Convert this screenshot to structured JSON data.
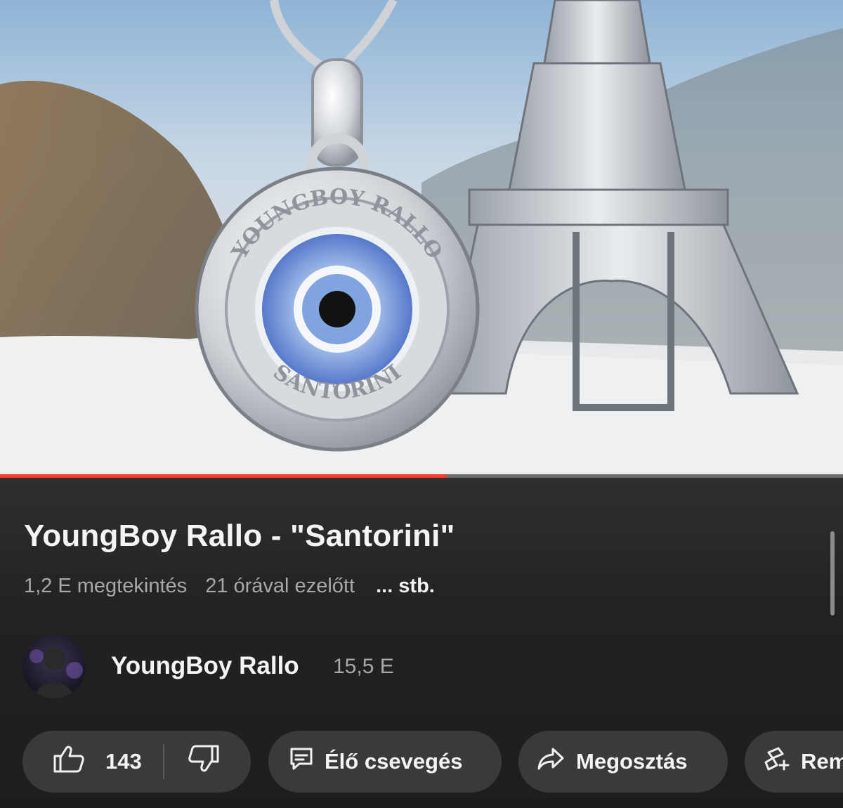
{
  "video": {
    "progress_fraction": 0.53,
    "progress_color": "#ff3b30",
    "thumbnail_description_icon": "pendant-eiffel-thumbnail",
    "pendant_top_text": "YOUNGBOY RALLO",
    "pendant_bottom_text": "SANTORINI"
  },
  "title": "YoungBoy Rallo - \"Santorini\"",
  "meta": {
    "views": "1,2 E megtekintés",
    "age": "21 órával ezelőtt",
    "more": "... stb."
  },
  "channel": {
    "name": "YoungBoy Rallo",
    "subscribers": "15,5 E"
  },
  "actions": {
    "like_count": "143",
    "like_icon": "thumbs-up-icon",
    "dislike_icon": "thumbs-down-icon",
    "chat_label": "Élő csevegés",
    "chat_icon": "chat-icon",
    "share_label": "Megosztás",
    "share_icon": "share-icon",
    "remix_label": "Rem",
    "remix_icon": "remix-icon"
  },
  "colors": {
    "background": "#232323",
    "pill": "#3a3a3a",
    "secondary_text": "#a9a9a9"
  }
}
